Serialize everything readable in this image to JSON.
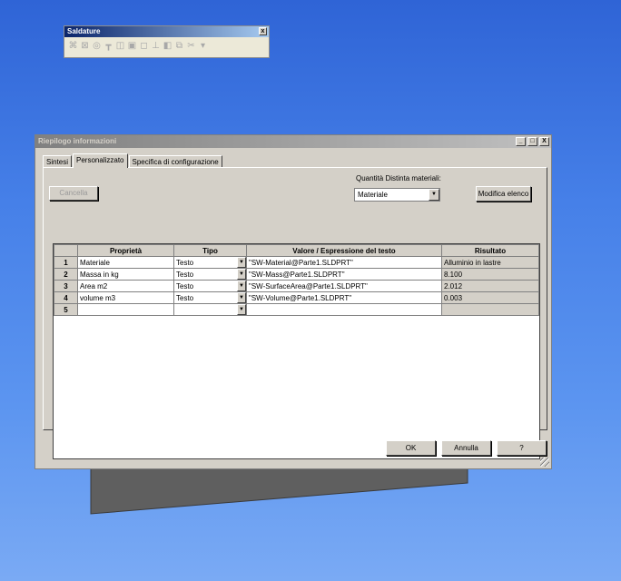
{
  "toolbar": {
    "title": "Saldature",
    "close_glyph": "x",
    "icons": [
      "weld-icon",
      "structure-icon",
      "trim-icon",
      "gusset-icon",
      "endcap-icon",
      "fillet-icon",
      "cutlist-icon",
      "plate-icon",
      "cap-icon",
      "extrude-icon",
      "cut-icon",
      "options-icon"
    ]
  },
  "dialog": {
    "title": "Riepilogo informazioni",
    "min_glyph": "_",
    "max_glyph": "□",
    "close_glyph": "X",
    "tabs": [
      {
        "label": "Sintesi"
      },
      {
        "label": "Personalizzato"
      },
      {
        "label": "Specifica di configurazione"
      }
    ],
    "cancel_label": "Cancella",
    "bom_label": "Quantità Distinta materiali:",
    "bom_value": "Materiale",
    "edit_list_label": "Modifica elenco",
    "grid": {
      "headers": [
        "Proprietà",
        "Tipo",
        "Valore / Espressione del testo",
        "Risultato"
      ],
      "rows": [
        {
          "num": "1",
          "prop": "Materiale",
          "type": "Testo",
          "value": "\"SW-Material@Parte1.SLDPRT\"",
          "result": "Alluminio in lastre"
        },
        {
          "num": "2",
          "prop": "Massa in kg",
          "type": "Testo",
          "value": "\"SW-Mass@Parte1.SLDPRT\"",
          "result": "8.100"
        },
        {
          "num": "3",
          "prop": "Area m2",
          "type": "Testo",
          "value": "\"SW-SurfaceArea@Parte1.SLDPRT\"",
          "result": "2.012"
        },
        {
          "num": "4",
          "prop": "volume m3",
          "type": "Testo",
          "value": "\"SW-Volume@Parte1.SLDPRT\"",
          "result": "0.003"
        },
        {
          "num": "5",
          "prop": "",
          "type": "",
          "value": "",
          "result": ""
        }
      ]
    },
    "ok_label": "OK",
    "cancel_button_label": "Annulla",
    "help_label": "?"
  },
  "colors": {
    "desktop": "#4680e8",
    "dialog": "#d4d0c8",
    "shape": "#5a5a5a"
  }
}
